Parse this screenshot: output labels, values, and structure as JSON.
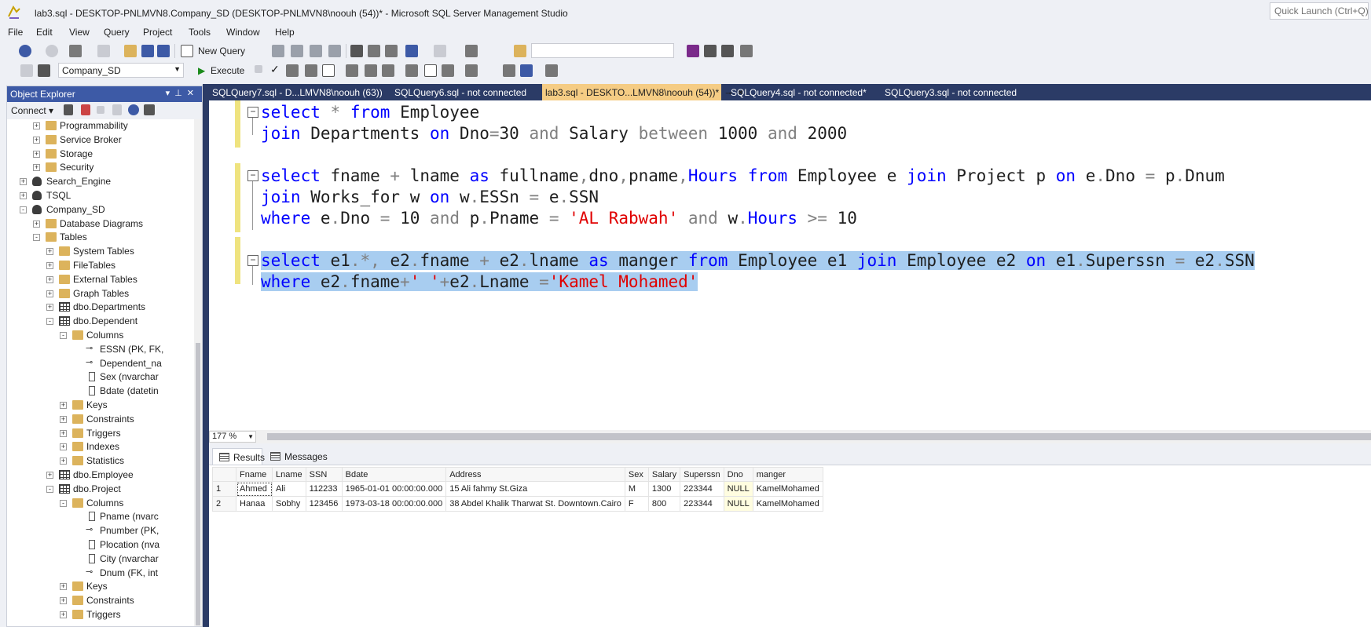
{
  "window": {
    "title": "lab3.sql - DESKTOP-PNLMVN8.Company_SD (DESKTOP-PNLMVN8\\noouh (54))* - Microsoft SQL Server Management Studio",
    "quick_launch": "Quick Launch (Ctrl+Q)"
  },
  "menu": [
    "File",
    "Edit",
    "View",
    "Query",
    "Project",
    "Tools",
    "Window",
    "Help"
  ],
  "toolbar": {
    "new_query": "New Query",
    "database": "Company_SD",
    "execute": "Execute",
    "search_combo": ""
  },
  "object_explorer": {
    "title": "Object Explorer",
    "connect": "Connect",
    "nodes": [
      {
        "label": "Programmability",
        "icon": "folder-icon",
        "expander": "+"
      },
      {
        "label": "Service Broker",
        "icon": "folder-icon",
        "expander": "+"
      },
      {
        "label": "Storage",
        "icon": "folder-icon",
        "expander": "+"
      },
      {
        "label": "Security",
        "icon": "folder-icon",
        "expander": "+"
      },
      {
        "label": "Search_Engine",
        "icon": "database-icon",
        "expander": "+"
      },
      {
        "label": "TSQL",
        "icon": "database-icon",
        "expander": "+"
      },
      {
        "label": "Company_SD",
        "icon": "database-icon",
        "expander": "-"
      },
      {
        "label": "Database Diagrams",
        "icon": "folder-icon",
        "expander": "+"
      },
      {
        "label": "Tables",
        "icon": "folder-icon",
        "expander": "-"
      },
      {
        "label": "System Tables",
        "icon": "folder-icon",
        "expander": "+"
      },
      {
        "label": "FileTables",
        "icon": "folder-icon",
        "expander": "+"
      },
      {
        "label": "External Tables",
        "icon": "folder-icon",
        "expander": "+"
      },
      {
        "label": "Graph Tables",
        "icon": "folder-icon",
        "expander": "+"
      },
      {
        "label": "dbo.Departments",
        "icon": "table-icon",
        "expander": "+"
      },
      {
        "label": "dbo.Dependent",
        "icon": "table-icon",
        "expander": "-"
      },
      {
        "label": "Columns",
        "icon": "folder-icon",
        "expander": "-"
      },
      {
        "label": "ESSN (PK, FK,",
        "icon": "key-icon",
        "expander": ""
      },
      {
        "label": "Dependent_na",
        "icon": "key-icon",
        "expander": ""
      },
      {
        "label": "Sex (nvarchar",
        "icon": "column-icon",
        "expander": ""
      },
      {
        "label": "Bdate (datetin",
        "icon": "column-icon",
        "expander": ""
      },
      {
        "label": "Keys",
        "icon": "folder-icon",
        "expander": "+"
      },
      {
        "label": "Constraints",
        "icon": "folder-icon",
        "expander": "+"
      },
      {
        "label": "Triggers",
        "icon": "folder-icon",
        "expander": "+"
      },
      {
        "label": "Indexes",
        "icon": "folder-icon",
        "expander": "+"
      },
      {
        "label": "Statistics",
        "icon": "folder-icon",
        "expander": "+"
      },
      {
        "label": "dbo.Employee",
        "icon": "table-icon",
        "expander": "+"
      },
      {
        "label": "dbo.Project",
        "icon": "table-icon",
        "expander": "-"
      },
      {
        "label": "Columns",
        "icon": "folder-icon",
        "expander": "-"
      },
      {
        "label": "Pname (nvarc",
        "icon": "column-icon",
        "expander": ""
      },
      {
        "label": "Pnumber (PK,",
        "icon": "key-icon",
        "expander": ""
      },
      {
        "label": "Plocation (nva",
        "icon": "column-icon",
        "expander": ""
      },
      {
        "label": "City (nvarchar",
        "icon": "column-icon",
        "expander": ""
      },
      {
        "label": "Dnum (FK, int",
        "icon": "key-icon",
        "expander": ""
      },
      {
        "label": "Keys",
        "icon": "folder-icon",
        "expander": "+"
      },
      {
        "label": "Constraints",
        "icon": "folder-icon",
        "expander": "+"
      },
      {
        "label": "Triggers",
        "icon": "folder-icon",
        "expander": "+"
      }
    ]
  },
  "tabs": [
    {
      "label": "SQLQuery7.sql - D...LMVN8\\noouh (63))",
      "active": false
    },
    {
      "label": "SQLQuery6.sql - not connected",
      "active": false
    },
    {
      "label": "lab3.sql - DESKTO...LMVN8\\noouh (54))*",
      "active": true
    },
    {
      "label": "SQLQuery4.sql - not connected*",
      "active": false
    },
    {
      "label": "SQLQuery3.sql - not connected",
      "active": false
    }
  ],
  "editor": {
    "zoom": "177 %",
    "lines": [
      "select * from Employee",
      "join Departments on Dno=30 and Salary between 1000 and 2000",
      "",
      "select fname + lname as fullname,dno,pname,Hours from Employee e join Project p on e.Dno = p.Dnum",
      "join Works_for w on w.ESSn = e.SSN",
      "where e.Dno = 10 and p.Pname = 'AL Rabwah' and w.Hours >= 10",
      "",
      "select e1.*, e2.fname + e2.lname as manger from Employee e1 join Employee e2 on e1.Superssn = e2.SSN",
      "where e2.fname+' '+e2.Lname ='Kamel Mohamed'"
    ]
  },
  "results": {
    "tabs": [
      "Results",
      "Messages"
    ],
    "columns": [
      "",
      "Fname",
      "Lname",
      "SSN",
      "Bdate",
      "Address",
      "Sex",
      "Salary",
      "Superssn",
      "Dno",
      "manger"
    ],
    "rows": [
      [
        "1",
        "Ahmed",
        "Ali",
        "112233",
        "1965-01-01 00:00:00.000",
        "15 Ali fahmy St.Giza",
        "M",
        "1300",
        "223344",
        "NULL",
        "KamelMohamed"
      ],
      [
        "2",
        "Hanaa",
        "Sobhy",
        "123456",
        "1973-03-18 00:00:00.000",
        "38 Abdel Khalik Tharwat St. Downtown.Cairo",
        "F",
        "800",
        "223344",
        "NULL",
        "KamelMohamed"
      ]
    ]
  },
  "colors": {
    "keyword": "#0000ff",
    "string": "#e00000",
    "operator": "#808080",
    "selection": "#a8cdf0",
    "tab_active": "#f5cc84",
    "panel_header": "#3d5aa6"
  }
}
